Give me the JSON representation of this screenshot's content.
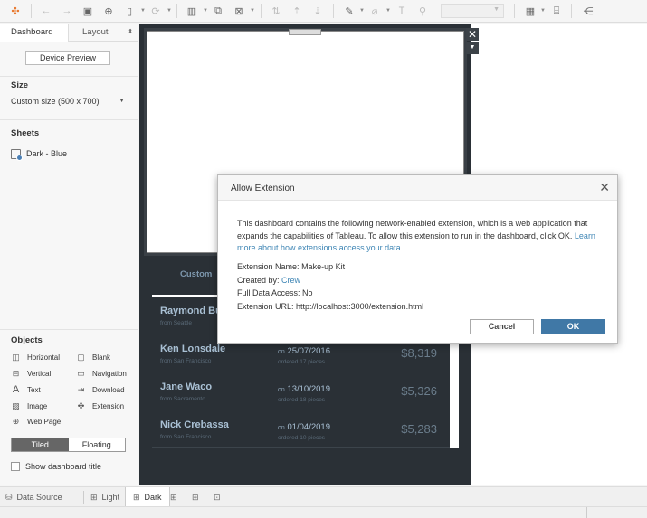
{
  "toolbar": {
    "icons": [
      "tableau-logo-icon",
      "undo-icon",
      "redo-icon",
      "save-icon",
      "new-datasource-icon",
      "pause-updates-icon",
      "refresh-icon",
      "new-worksheet-icon",
      "duplicate-sheet-icon",
      "clear-sheet-icon",
      "swap-icon",
      "sort-ascending-icon",
      "sort-descending-icon",
      "highlight-icon",
      "group-icon",
      "labels-icon",
      "fix-axes-icon",
      "show-me-icon",
      "presentation-icon",
      "share-icon"
    ]
  },
  "left_panel": {
    "tabs": {
      "dashboard": "Dashboard",
      "layout": "Layout"
    },
    "device_preview": "Device Preview",
    "size": {
      "title": "Size",
      "value": "Custom size (500 x 700)"
    },
    "sheets": {
      "title": "Sheets",
      "items": [
        "Dark - Blue"
      ]
    },
    "objects": {
      "title": "Objects",
      "items": [
        "Horizontal",
        "Blank",
        "Vertical",
        "Navigation",
        "Text",
        "Download",
        "Image",
        "Extension",
        "Web Page"
      ]
    },
    "layout_mode": {
      "tiled": "Tiled",
      "floating": "Floating",
      "selected": "Tiled"
    },
    "show_title": "Show dashboard title"
  },
  "dashboard": {
    "customer_header": "Custom",
    "rows": [
      {
        "name": "Raymond Bu",
        "from": "from Seattle",
        "date": "",
        "pieces": "",
        "amount": ""
      },
      {
        "name": "Ken Lonsdale",
        "from": "from San Francisco",
        "date_prefix": "on",
        "date": "25/07/2016",
        "pieces_prefix": "ordered",
        "pieces": "17",
        "pieces_suffix": "pieces",
        "amount": "$8,319"
      },
      {
        "name": "Jane Waco",
        "from": "from Sacramento",
        "date_prefix": "on",
        "date": "13/10/2019",
        "pieces_prefix": "ordered",
        "pieces": "18",
        "pieces_suffix": "pieces",
        "amount": "$5,326"
      },
      {
        "name": "Nick Crebassa",
        "from": "from San Francisco",
        "date_prefix": "on",
        "date": "01/04/2019",
        "pieces_prefix": "ordered",
        "pieces": "10",
        "pieces_suffix": "pieces",
        "amount": "$5,283"
      }
    ]
  },
  "dialog": {
    "title": "Allow Extension",
    "message": "This dashboard contains the following network-enabled extension, which is a web application that expands the capabilities of Tableau. To allow this extension to run in the dashboard, click OK.",
    "learn_more": "Learn more about how extensions access your data.",
    "extension_name_label": "Extension Name:",
    "extension_name": "Make-up Kit",
    "created_by_label": "Created by:",
    "created_by": "Crew",
    "full_data_access_label": "Full Data Access:",
    "full_data_access": "No",
    "extension_url_label": "Extension URL:",
    "extension_url": "http://localhost:3000/extension.html",
    "cancel": "Cancel",
    "ok": "OK"
  },
  "bottom_tabs": {
    "data_source": "Data Source",
    "sheets": [
      "Light",
      "Dark"
    ],
    "active": "Dark"
  },
  "colors": {
    "accent": "#4078a6",
    "dashboard_bg": "#2a3036",
    "link": "#3f86b5"
  }
}
